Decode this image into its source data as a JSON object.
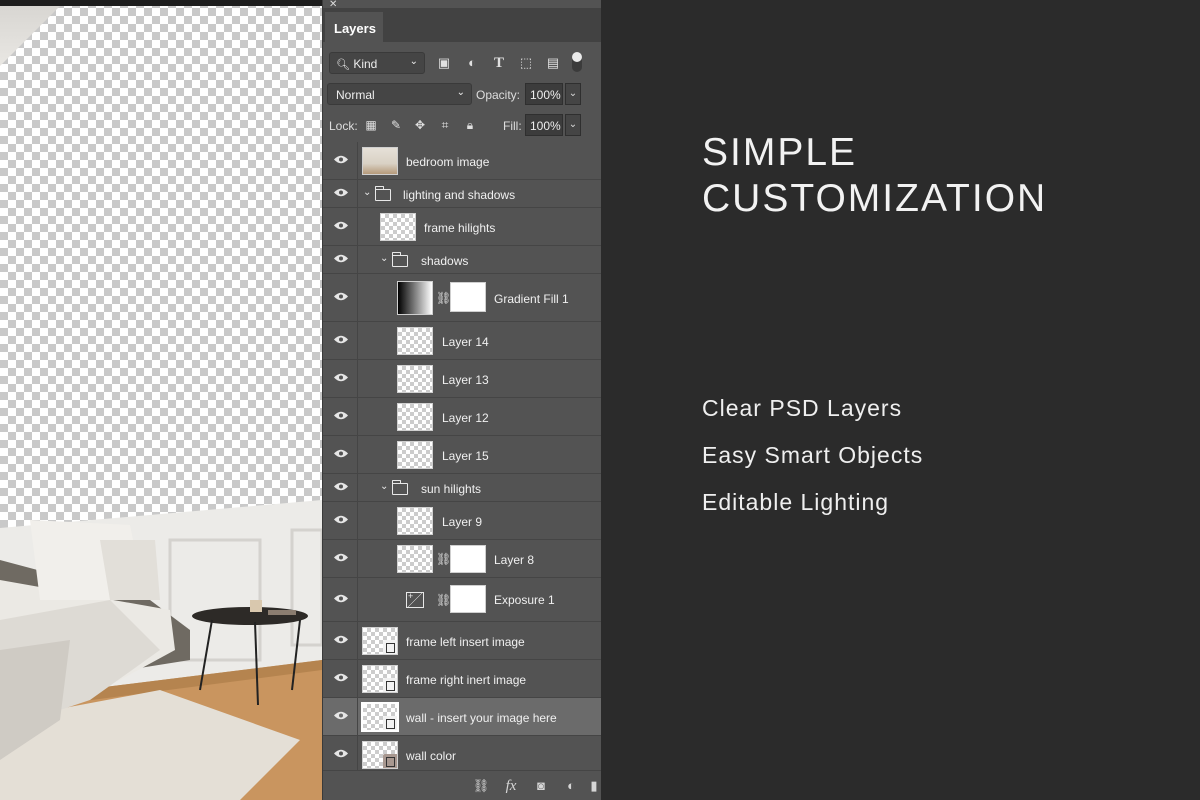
{
  "panel": {
    "tab_label": "Layers",
    "filter_kind": "Kind",
    "blend_mode": "Normal",
    "opacity_label": "Opacity:",
    "opacity_value": "100%",
    "lock_label": "Lock:",
    "fill_label": "Fill:",
    "fill_value": "100%"
  },
  "layers": [
    {
      "name": "bedroom image"
    },
    {
      "name": "lighting and shadows"
    },
    {
      "name": "frame hilights"
    },
    {
      "name": "shadows"
    },
    {
      "name": "Gradient Fill 1"
    },
    {
      "name": "Layer 14"
    },
    {
      "name": "Layer 13"
    },
    {
      "name": "Layer 12"
    },
    {
      "name": "Layer 15"
    },
    {
      "name": "sun hilights"
    },
    {
      "name": "Layer 9"
    },
    {
      "name": "Layer 8"
    },
    {
      "name": "Exposure 1"
    },
    {
      "name": "frame left insert image"
    },
    {
      "name": "frame right inert image"
    },
    {
      "name": "wall - insert your image here",
      "selected": true
    },
    {
      "name": "wall color"
    }
  ],
  "promo": {
    "headline_line1": "SIMPLE",
    "headline_line2": "CUSTOMIZATION",
    "features": [
      "Clear PSD Layers",
      "Easy Smart Objects",
      "Editable Lighting"
    ]
  },
  "colors": {
    "panel_bg": "#535353",
    "promo_bg": "#2b2b2b",
    "selected_row": "#6b6b6b"
  }
}
